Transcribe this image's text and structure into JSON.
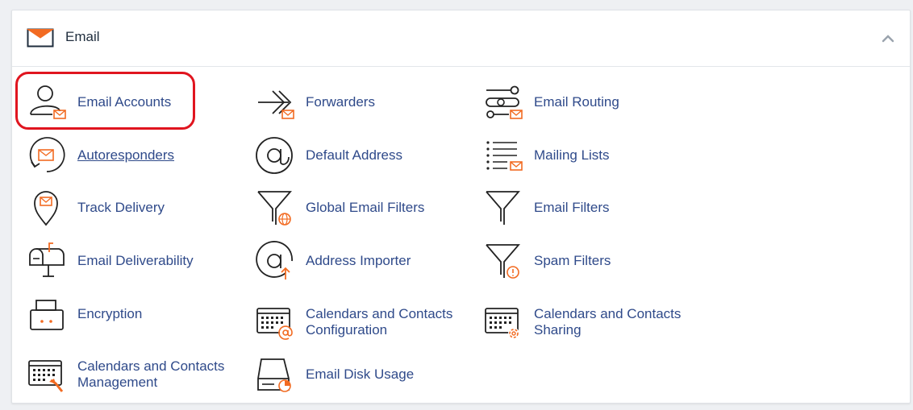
{
  "section": {
    "title": "Email",
    "icon": "envelope-icon",
    "collapse_icon": "chevron-up-icon"
  },
  "colors": {
    "link": "#2f4a8a",
    "accent": "#f26b22",
    "highlight": "#e0151f"
  },
  "items": [
    {
      "label": "Email Accounts",
      "icon": "email-accounts-icon"
    },
    {
      "label": "Forwarders",
      "icon": "forwarders-icon"
    },
    {
      "label": "Email Routing",
      "icon": "email-routing-icon"
    },
    {
      "label": "Autoresponders",
      "icon": "autoresponders-icon"
    },
    {
      "label": "Default Address",
      "icon": "at-sign-icon"
    },
    {
      "label": "Mailing Lists",
      "icon": "mailing-lists-icon"
    },
    {
      "label": "Track Delivery",
      "icon": "map-pin-icon"
    },
    {
      "label": "Global Email Filters",
      "icon": "global-filter-icon"
    },
    {
      "label": "Email Filters",
      "icon": "filter-icon"
    },
    {
      "label": "Email Deliverability",
      "icon": "mailbox-icon"
    },
    {
      "label": "Address Importer",
      "icon": "address-importer-icon"
    },
    {
      "label": "Spam Filters",
      "icon": "spam-filter-icon"
    },
    {
      "label": "Encryption",
      "icon": "encryption-icon"
    },
    {
      "label": "Calendars and Contacts Configuration",
      "icon": "calendar-config-icon"
    },
    {
      "label": "Calendars and Contacts Sharing",
      "icon": "calendar-sharing-icon"
    },
    {
      "label": "Calendars and Contacts Management",
      "icon": "calendar-management-icon"
    },
    {
      "label": "Email Disk Usage",
      "icon": "disk-usage-icon"
    }
  ]
}
